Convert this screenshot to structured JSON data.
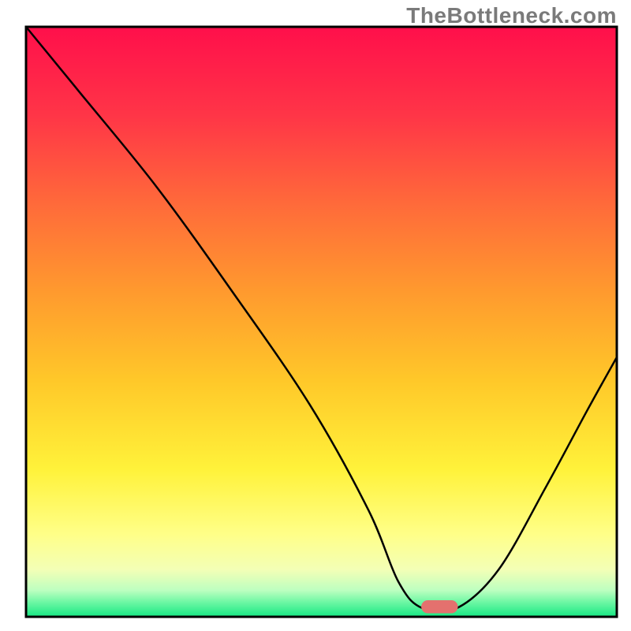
{
  "watermark": "TheBottleneck.com",
  "chart_data": {
    "type": "line",
    "title": "",
    "xlabel": "",
    "ylabel": "",
    "xlim": [
      0,
      100
    ],
    "ylim": [
      0,
      100
    ],
    "grid": false,
    "legend": false,
    "background": {
      "type": "vertical-gradient",
      "stops": [
        {
          "pos": 0.0,
          "color": "#ff0f4b"
        },
        {
          "pos": 0.15,
          "color": "#ff3547"
        },
        {
          "pos": 0.3,
          "color": "#ff6a3a"
        },
        {
          "pos": 0.45,
          "color": "#ff9a2e"
        },
        {
          "pos": 0.6,
          "color": "#ffc829"
        },
        {
          "pos": 0.75,
          "color": "#fff23a"
        },
        {
          "pos": 0.86,
          "color": "#ffff88"
        },
        {
          "pos": 0.92,
          "color": "#f3ffb6"
        },
        {
          "pos": 0.955,
          "color": "#bdffc0"
        },
        {
          "pos": 0.975,
          "color": "#6ef7a4"
        },
        {
          "pos": 1.0,
          "color": "#17e884"
        }
      ]
    },
    "series": [
      {
        "name": "bottleneck-curve",
        "color": "#000000",
        "width": 2.5,
        "x": [
          0.0,
          9.0,
          22.0,
          35.0,
          48.0,
          58.0,
          63.0,
          67.0,
          73.0,
          80.0,
          88.0,
          95.0,
          100.0
        ],
        "values": [
          100.0,
          89.0,
          73.0,
          55.0,
          36.0,
          18.0,
          6.0,
          1.5,
          1.5,
          8.0,
          22.0,
          35.0,
          44.0
        ]
      }
    ],
    "markers": [
      {
        "name": "selected-point",
        "shape": "rounded-rect",
        "xc": 70.0,
        "yc": 1.7,
        "w": 6.2,
        "h": 2.2,
        "color": "#e4716e"
      }
    ],
    "frame": {
      "stroke": "#000000",
      "width": 3
    }
  }
}
